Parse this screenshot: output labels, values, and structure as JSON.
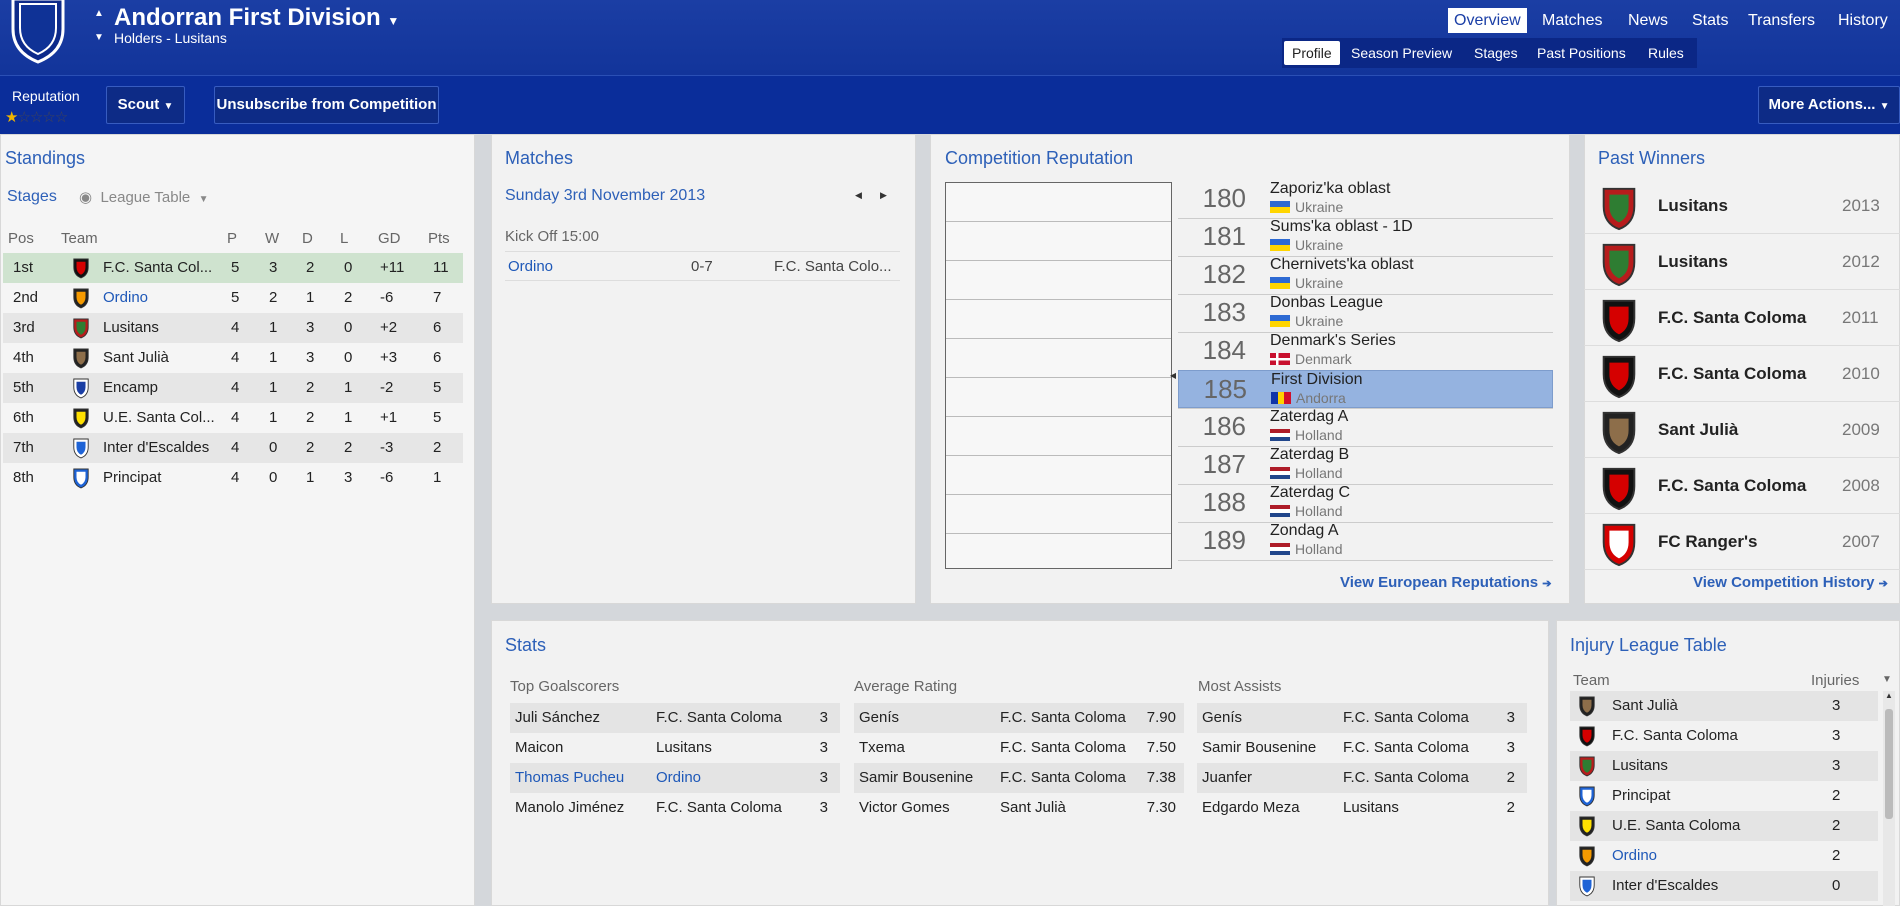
{
  "header": {
    "title": "Andorran First Division",
    "subtitle": "Holders - Lusitans",
    "nav": [
      "Overview",
      "Matches",
      "News",
      "Stats",
      "Transfers",
      "History"
    ],
    "subnav": [
      "Profile",
      "Season Preview",
      "Stages",
      "Past Positions",
      "Rules"
    ]
  },
  "toolbar": {
    "reputation_label": "Reputation",
    "scout": "Scout",
    "unsubscribe": "Unsubscribe from Competition",
    "more_actions": "More Actions...",
    "reputation_stars": 0.5
  },
  "standings": {
    "title": "Standings",
    "stages": "Stages",
    "view": "League Table",
    "headers": [
      "Pos",
      "Team",
      "P",
      "W",
      "D",
      "L",
      "GD",
      "Pts"
    ],
    "rows": [
      {
        "pos": "1st",
        "team": "F.C. Santa Col...",
        "p": "5",
        "w": "3",
        "d": "2",
        "l": "0",
        "gd": "+11",
        "pts": "11"
      },
      {
        "pos": "2nd",
        "team": "Ordino",
        "p": "5",
        "w": "2",
        "d": "1",
        "l": "2",
        "gd": "-6",
        "pts": "7"
      },
      {
        "pos": "3rd",
        "team": "Lusitans",
        "p": "4",
        "w": "1",
        "d": "3",
        "l": "0",
        "gd": "+2",
        "pts": "6"
      },
      {
        "pos": "4th",
        "team": "Sant Julià",
        "p": "4",
        "w": "1",
        "d": "3",
        "l": "0",
        "gd": "+3",
        "pts": "6"
      },
      {
        "pos": "5th",
        "team": "Encamp",
        "p": "4",
        "w": "1",
        "d": "2",
        "l": "1",
        "gd": "-2",
        "pts": "5"
      },
      {
        "pos": "6th",
        "team": "U.E. Santa Col...",
        "p": "4",
        "w": "1",
        "d": "2",
        "l": "1",
        "gd": "+1",
        "pts": "5"
      },
      {
        "pos": "7th",
        "team": "Inter d'Escaldes",
        "p": "4",
        "w": "0",
        "d": "2",
        "l": "2",
        "gd": "-3",
        "pts": "2"
      },
      {
        "pos": "8th",
        "team": "Principat",
        "p": "4",
        "w": "0",
        "d": "1",
        "l": "3",
        "gd": "-6",
        "pts": "1"
      }
    ]
  },
  "matches": {
    "title": "Matches",
    "date": "Sunday 3rd November 2013",
    "kickoff": "Kick Off 15:00",
    "home": "Ordino",
    "score": "0-7",
    "away": "F.C. Santa Colo..."
  },
  "reputation": {
    "title": "Competition Reputation",
    "link": "View European Reputations",
    "rows": [
      {
        "rank": "180",
        "name": "Zaporiz'ka oblast",
        "country": "Ukraine"
      },
      {
        "rank": "181",
        "name": "Sums'ka oblast - 1D",
        "country": "Ukraine"
      },
      {
        "rank": "182",
        "name": "Chernivets'ka oblast",
        "country": "Ukraine"
      },
      {
        "rank": "183",
        "name": "Donbas League",
        "country": "Ukraine"
      },
      {
        "rank": "184",
        "name": "Denmark's Series",
        "country": "Denmark"
      },
      {
        "rank": "185",
        "name": "First Division",
        "country": "Andorra"
      },
      {
        "rank": "186",
        "name": "Zaterdag A",
        "country": "Holland"
      },
      {
        "rank": "187",
        "name": "Zaterdag B",
        "country": "Holland"
      },
      {
        "rank": "188",
        "name": "Zaterdag C",
        "country": "Holland"
      },
      {
        "rank": "189",
        "name": "Zondag A",
        "country": "Holland"
      }
    ]
  },
  "past_winners": {
    "title": "Past Winners",
    "link": "View Competition History",
    "rows": [
      {
        "team": "Lusitans",
        "year": "2013"
      },
      {
        "team": "Lusitans",
        "year": "2012"
      },
      {
        "team": "F.C. Santa Coloma",
        "year": "2011"
      },
      {
        "team": "F.C. Santa Coloma",
        "year": "2010"
      },
      {
        "team": "Sant Julià",
        "year": "2009"
      },
      {
        "team": "F.C. Santa Coloma",
        "year": "2008"
      },
      {
        "team": "FC Ranger's",
        "year": "2007"
      }
    ]
  },
  "stats": {
    "title": "Stats",
    "goalscorers": {
      "title": "Top Goalscorers",
      "rows": [
        {
          "player": "Juli Sánchez",
          "team": "F.C. Santa Coloma",
          "value": "3"
        },
        {
          "player": "Maicon",
          "team": "Lusitans",
          "value": "3"
        },
        {
          "player": "Thomas Pucheu",
          "team": "Ordino",
          "value": "3"
        },
        {
          "player": "Manolo Jiménez",
          "team": "F.C. Santa Coloma",
          "value": "3"
        }
      ]
    },
    "rating": {
      "title": "Average Rating",
      "rows": [
        {
          "player": "Genís",
          "team": "F.C. Santa Coloma",
          "value": "7.90"
        },
        {
          "player": "Txema",
          "team": "F.C. Santa Coloma",
          "value": "7.50"
        },
        {
          "player": "Samir Bousenine",
          "team": "F.C. Santa Coloma",
          "value": "7.38"
        },
        {
          "player": "Victor Gomes",
          "team": "Sant Julià",
          "value": "7.30"
        }
      ]
    },
    "assists": {
      "title": "Most Assists",
      "rows": [
        {
          "player": "Genís",
          "team": "F.C. Santa Coloma",
          "value": "3"
        },
        {
          "player": "Samir Bousenine",
          "team": "F.C. Santa Coloma",
          "value": "3"
        },
        {
          "player": "Juanfer",
          "team": "F.C. Santa Coloma",
          "value": "2"
        },
        {
          "player": "Edgardo Meza",
          "team": "Lusitans",
          "value": "2"
        }
      ]
    }
  },
  "injury": {
    "title": "Injury League Table",
    "headers": [
      "Team",
      "Injuries"
    ],
    "rows": [
      {
        "team": "Sant Julià",
        "value": "3"
      },
      {
        "team": "F.C. Santa Coloma",
        "value": "3"
      },
      {
        "team": "Lusitans",
        "value": "3"
      },
      {
        "team": "Principat",
        "value": "2"
      },
      {
        "team": "U.E. Santa Coloma",
        "value": "2"
      },
      {
        "team": "Ordino",
        "value": "2"
      },
      {
        "team": "Inter d'Escaldes",
        "value": "0"
      }
    ]
  },
  "colors": {
    "header": "#1b3ea4",
    "link": "#1e58b8",
    "highlight": "#95b3e0"
  }
}
